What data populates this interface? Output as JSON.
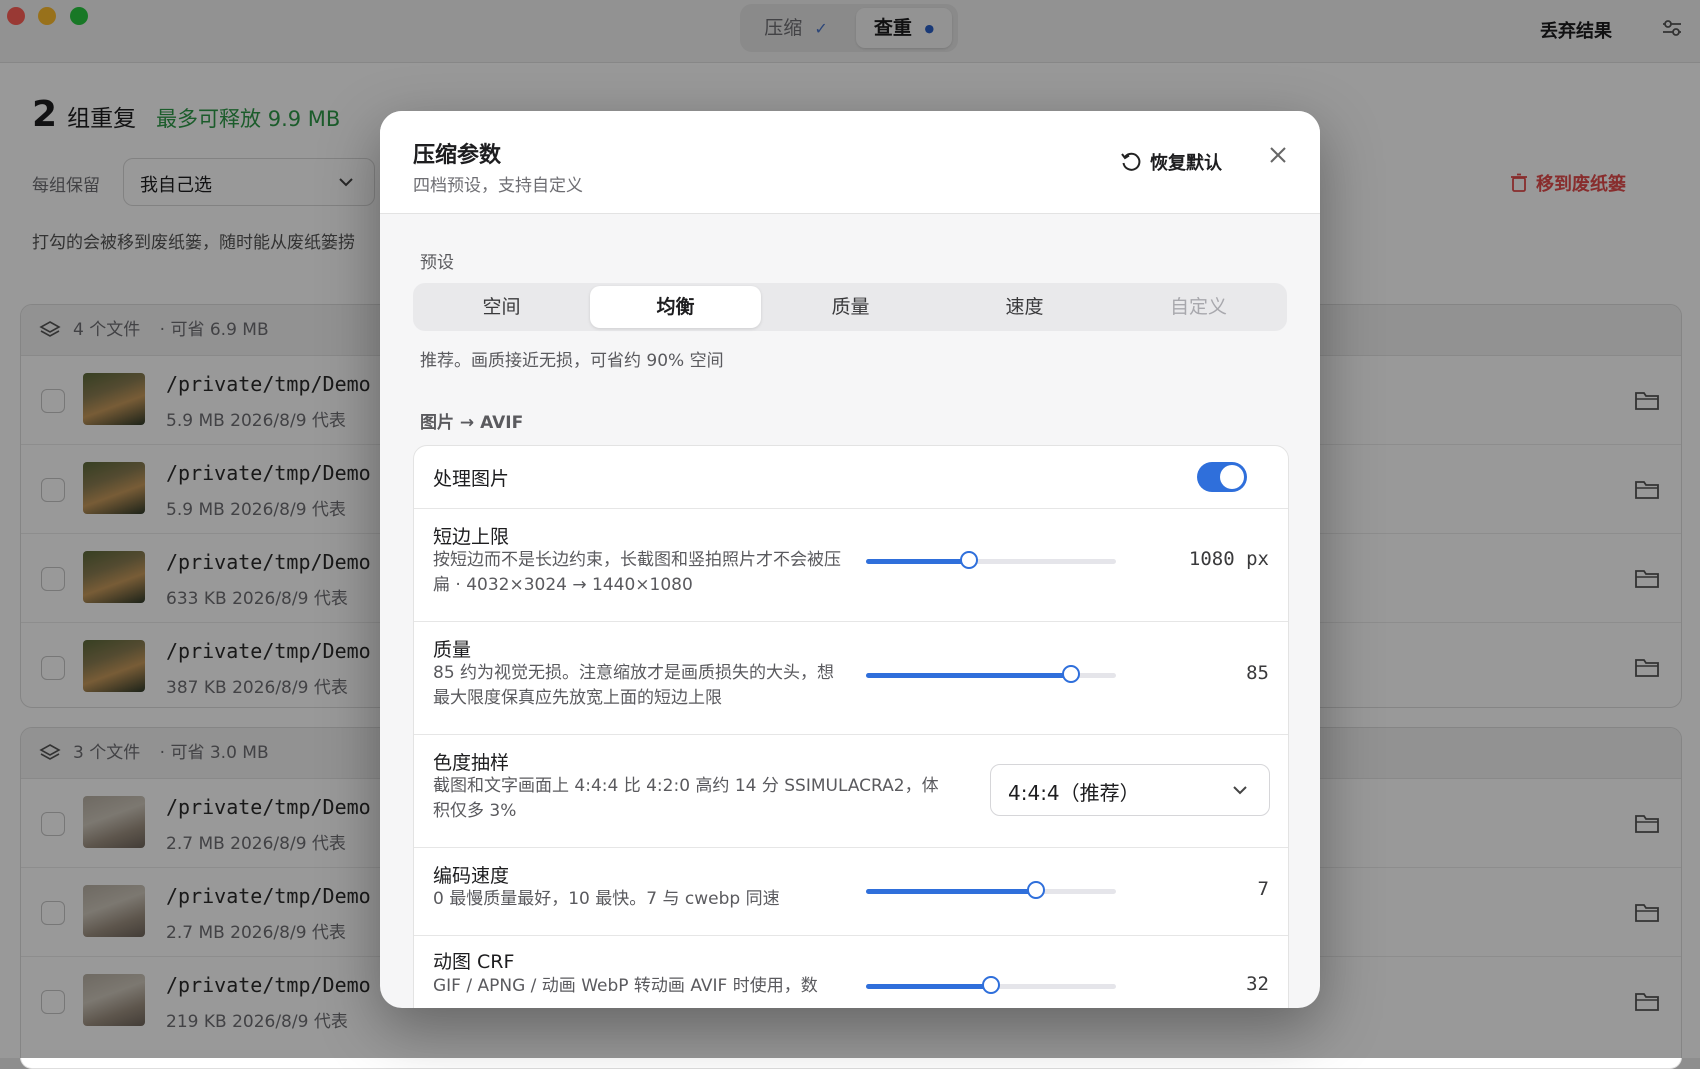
{
  "window": {
    "segments": [
      {
        "label": "压缩",
        "mark": "✓"
      },
      {
        "label": "查重",
        "mark": "●"
      }
    ],
    "discard_label": "丢弃结果"
  },
  "summary": {
    "count": "2",
    "count_unit": "组重复",
    "freeable": "最多可释放 9.9 MB",
    "keep_label": "每组保留",
    "keep_value": "我自己选",
    "hint": "打勾的会被移到废纸篓，随时能从废纸篓捞",
    "trash_button": "移到废纸篓"
  },
  "groups": [
    {
      "files": "4 个文件",
      "saving": "· 可省 6.9 MB",
      "rows": [
        {
          "path": "/private/tmp/Demo",
          "meta": "5.9 MB   2026/8/9   代表"
        },
        {
          "path": "/private/tmp/Demo",
          "meta": "5.9 MB   2026/8/9   代表"
        },
        {
          "path": "/private/tmp/Demo",
          "meta": "633 KB   2026/8/9   代表"
        },
        {
          "path": "/private/tmp/Demo",
          "meta": "387 KB   2026/8/9   代表"
        }
      ]
    },
    {
      "files": "3 个文件",
      "saving": "· 可省 3.0 MB",
      "rows": [
        {
          "path": "/private/tmp/Demo",
          "meta": "2.7 MB   2026/8/9   代表"
        },
        {
          "path": "/private/tmp/Demo",
          "meta": "2.7 MB   2026/8/9   代表"
        },
        {
          "path": "/private/tmp/Demo",
          "meta": "219 KB   2026/8/9   代表"
        }
      ]
    }
  ],
  "modal": {
    "title": "压缩参数",
    "subtitle": "四档预设，支持自定义",
    "reset_label": "恢复默认",
    "preset_label": "预设",
    "presets": [
      "空间",
      "均衡",
      "质量",
      "速度",
      "自定义"
    ],
    "preset_desc": "推荐。画质接近无损，可省约 90% 空间",
    "image_section": "图片 → AVIF",
    "process_images_label": "处理图片",
    "process_images_on": true,
    "settings": {
      "short_edge": {
        "title": "短边上限",
        "desc": "按短边而不是长边约束，长截图和竖拍照片才不会被压扁 · 4032×3024 → 1440×1080",
        "value": "1080 px",
        "level": 0.41
      },
      "quality": {
        "title": "质量",
        "desc": "85 约为视觉无损。注意缩放才是画质损失的大头，想最大限度保真应先放宽上面的短边上限",
        "value": "85",
        "level": 0.82
      },
      "chroma": {
        "title": "色度抽样",
        "desc": "截图和文字画面上 4:4:4 比 4:2:0 高约 14 分 SSIMULACRA2，体积仅多 3%",
        "value": "4:4:4（推荐）"
      },
      "speed": {
        "title": "编码速度",
        "desc": "0 最慢质量最好，10 最快。7 与 cwebp 同速",
        "value": "7",
        "level": 0.68
      },
      "crf": {
        "title": "动图 CRF",
        "desc": "GIF / APNG / 动画 WebP 转动画 AVIF 时使用，数",
        "value": "32",
        "level": 0.5
      }
    }
  }
}
